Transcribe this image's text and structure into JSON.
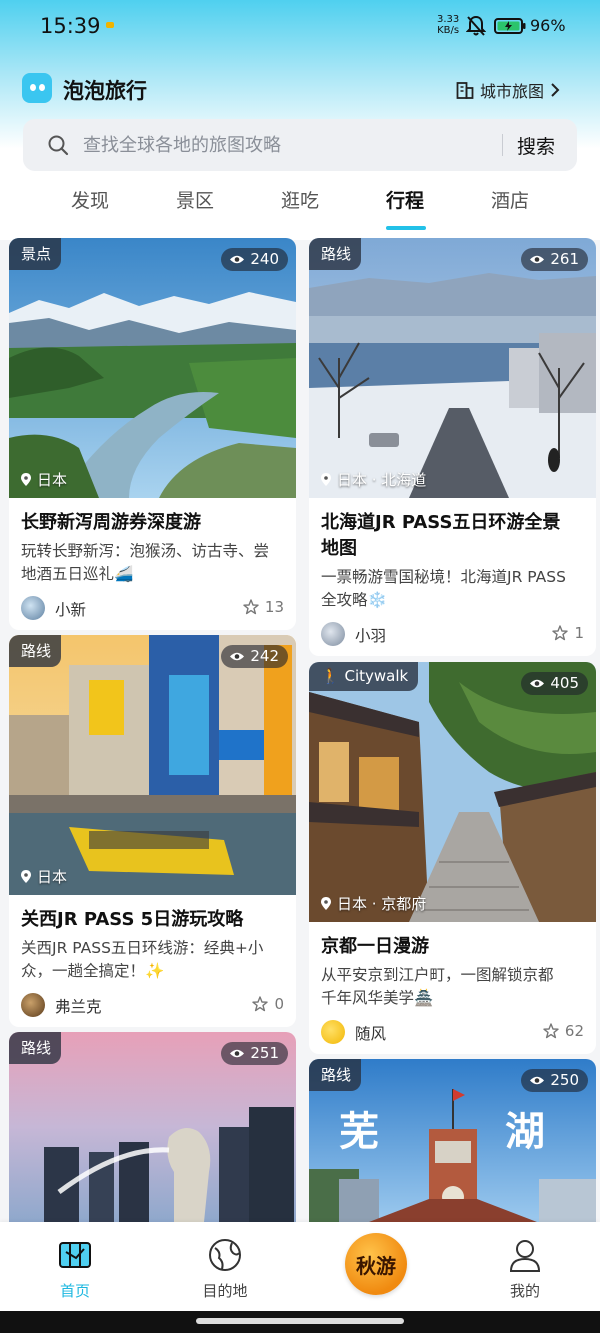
{
  "status_bar": {
    "time": "15:39",
    "net_speed_value": "3.33",
    "net_speed_unit": "KB/s",
    "battery": "96%"
  },
  "header": {
    "app_name": "泡泡旅行",
    "city_map_label": "城市旅图"
  },
  "search": {
    "placeholder": "查找全球各地的旅图攻略",
    "button_label": "搜索"
  },
  "tabs": [
    {
      "label": "发现",
      "active": false
    },
    {
      "label": "景区",
      "active": false
    },
    {
      "label": "逛吃",
      "active": false
    },
    {
      "label": "行程",
      "active": true
    },
    {
      "label": "酒店",
      "active": false
    }
  ],
  "cards": [
    {
      "tag": "景点",
      "views": "240",
      "location": "日本",
      "title": "长野新泻周游券深度游",
      "desc_line1": "玩转长野新泻：泡猴汤、访古寺、尝",
      "desc_line2": "地酒五日巡礼🚄",
      "author": "小新",
      "stars": "13"
    },
    {
      "tag": "路线",
      "views": "261",
      "location": "日本 · 北海道",
      "title_line1": "北海道JR PASS五日环游全景",
      "title_line2": "地图",
      "desc_line1": "一票畅游雪国秘境！北海道JR PASS",
      "desc_line2": "全攻略❄️",
      "author": "小羽",
      "stars": "1"
    },
    {
      "tag": "路线",
      "views": "242",
      "location": "日本",
      "title": "关西JR PASS 5日游玩攻略",
      "desc_line1": "关西JR PASS五日环线游：经典+小",
      "desc_line2": "众，一趟全搞定！✨",
      "author": "弗兰克",
      "stars": "0"
    },
    {
      "tag": "Citywalk",
      "views": "405",
      "location": "日本 · 京都府",
      "title": "京都一日漫游",
      "desc_line1": "从平安京到江户町，一图解锁京都",
      "desc_line2": "千年风华美学🏯",
      "author": "随风",
      "stars": "62"
    },
    {
      "tag": "路线",
      "views": "251"
    },
    {
      "tag": "路线",
      "views": "250",
      "cover_text_left": "芜",
      "cover_text_right": "湖"
    }
  ],
  "bottom_nav": {
    "home": "首页",
    "destination": "目的地",
    "promo": "秋游",
    "mine": "我的"
  },
  "colors": {
    "accent": "#22c1e8",
    "promo": "#f5a020"
  }
}
